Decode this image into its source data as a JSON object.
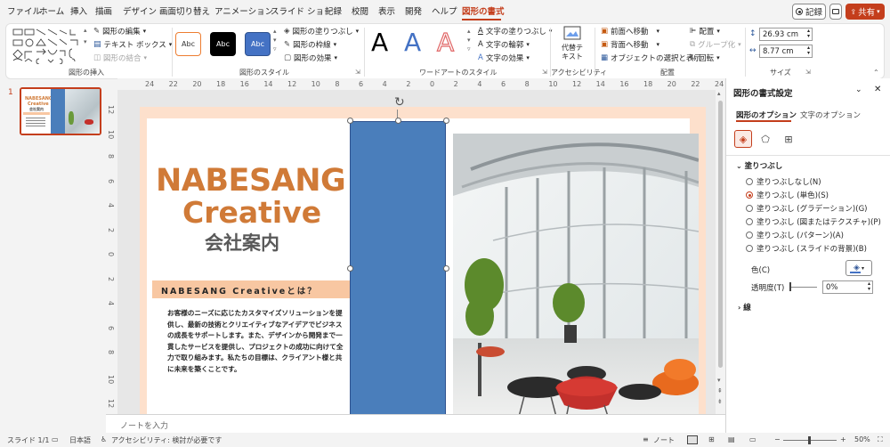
{
  "menu": {
    "tabs": [
      "ファイル",
      "ホーム",
      "挿入",
      "描画",
      "デザイン",
      "画面切り替え",
      "アニメーション",
      "スライド ショー",
      "記録",
      "校閲",
      "表示",
      "開発",
      "ヘルプ"
    ],
    "active_tab": "図形の書式",
    "record_label": "記録",
    "share_label": "共有",
    "accent": "#c43e1c"
  },
  "ribbon": {
    "insert_shapes": {
      "edit_shape": "図形の編集",
      "text_box": "テキスト ボックス",
      "merge_shapes": "図形の結合",
      "label": "図形の挿入"
    },
    "shape_styles": {
      "swatches": [
        "Abc",
        "Abc",
        "Abc"
      ],
      "fill": "図形の塗りつぶし",
      "outline": "図形の枠線",
      "effects": "図形の効果",
      "label": "図形のスタイル"
    },
    "wordart": {
      "samples": [
        "A",
        "A",
        "A"
      ],
      "text_fill": "文字の塗りつぶし",
      "text_outline": "文字の輪郭",
      "text_effects": "文字の効果",
      "label": "ワードアートのスタイル"
    },
    "accessibility": {
      "alt_text_line1": "代替テ",
      "alt_text_line2": "キスト",
      "label": "アクセシビリティ"
    },
    "arrange": {
      "bring_forward": "前面へ移動",
      "send_backward": "背面へ移動",
      "selection_pane": "オブジェクトの選択と表示",
      "align": "配置",
      "group": "グループ化",
      "rotate": "回転",
      "label": "配置"
    },
    "size": {
      "height": "26.93 cm",
      "width": "8.77 cm",
      "label": "サイズ"
    }
  },
  "thumbnail": {
    "number": "1",
    "title1": "NABESANG",
    "title2": "Creative",
    "subtitle": "会社案内"
  },
  "rulers": {
    "horizontal": [
      "24",
      "22",
      "20",
      "18",
      "16",
      "14",
      "12",
      "10",
      "8",
      "6",
      "4",
      "2",
      "0",
      "2",
      "4",
      "6",
      "8",
      "10",
      "12",
      "14",
      "16",
      "18",
      "20",
      "22",
      "24"
    ],
    "vertical": [
      "12",
      "10",
      "8",
      "6",
      "4",
      "2",
      "0",
      "2",
      "4",
      "6",
      "8",
      "10",
      "12"
    ]
  },
  "slide": {
    "title_line1": "NABESANG",
    "title_line2": "Creative",
    "subtitle": "会社案内",
    "band_text": "NABESANG Creativeとは？",
    "body": "お客様のニーズに応じたカスタマイズソリューションを提供し、最新の技術とクリエイティブなアイデアでビジネスの成長をサポートします。また、デザインから開発まで一貫したサービスを提供し、プロジェクトの成功に向けて全力で取り組みます。私たちの目標は、クライアント様と共に未来を築くことです。",
    "brand_color": "#d07a37",
    "band_color": "#f8c7a2",
    "shape_fill": "#4a7ebb"
  },
  "notes_placeholder": "ノートを入力",
  "format_pane": {
    "title": "図形の書式設定",
    "tab_shape": "図形のオプション",
    "tab_text": "文字のオプション",
    "section_fill": "塗りつぶし",
    "fill_options": [
      "塗りつぶしなし(N)",
      "塗りつぶし (単色)(S)",
      "塗りつぶし (グラデーション)(G)",
      "塗りつぶし (図またはテクスチャ)(P)",
      "塗りつぶし (パターン)(A)",
      "塗りつぶし (スライドの背景)(B)"
    ],
    "selected_fill": 1,
    "color_label": "色(C)",
    "transparency_label": "透明度(T)",
    "transparency_value": "0%",
    "section_line": "線"
  },
  "status": {
    "slide": "スライド 1/1",
    "language": "日本語",
    "accessibility": "アクセシビリティ: 検討が必要です",
    "notes": "ノート",
    "zoom": "50%"
  }
}
